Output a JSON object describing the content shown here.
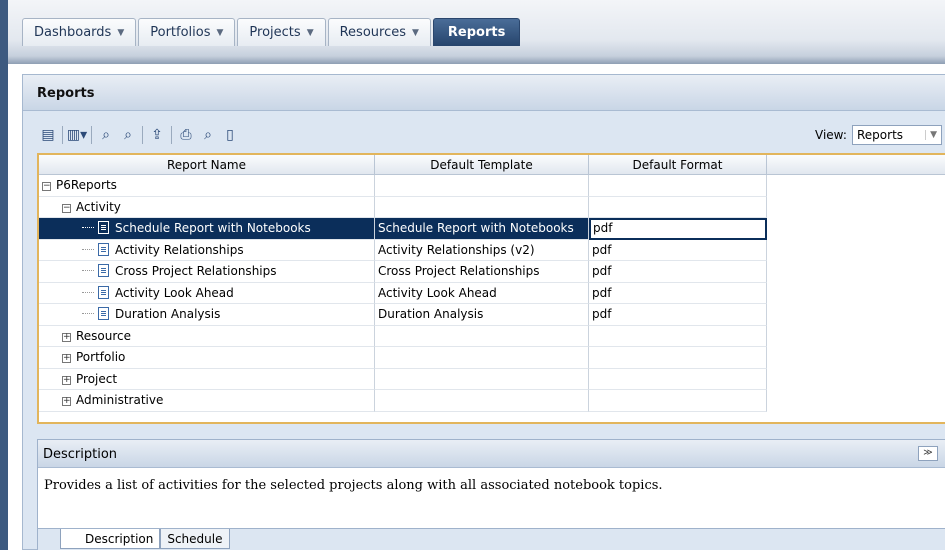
{
  "nav": {
    "tabs": [
      {
        "label": "Dashboards",
        "has_menu": true
      },
      {
        "label": "Portfolios",
        "has_menu": true
      },
      {
        "label": "Projects",
        "has_menu": true
      },
      {
        "label": "Resources",
        "has_menu": true
      },
      {
        "label": "Reports",
        "has_menu": false,
        "active": true
      }
    ]
  },
  "page": {
    "title": "Reports"
  },
  "toolbar": {
    "icons": [
      "open-report-icon",
      "columns-icon",
      "find-icon",
      "find-next-icon",
      "export-icon",
      "print-icon",
      "print-preview-icon",
      "page-setup-icon"
    ],
    "view_label": "View:",
    "view_value": "Reports"
  },
  "grid": {
    "columns": [
      "Report Name",
      "Default Template",
      "Default Format"
    ],
    "rows": [
      {
        "level": 0,
        "toggle": "−",
        "name": "P6Reports",
        "template": "",
        "format": ""
      },
      {
        "level": 1,
        "toggle": "−",
        "name": "Activity",
        "template": "",
        "format": ""
      },
      {
        "level": 2,
        "leaf": true,
        "name": "Schedule Report with Notebooks",
        "template": "Schedule Report with Notebooks",
        "format": "pdf",
        "selected": true
      },
      {
        "level": 2,
        "leaf": true,
        "name": "Activity Relationships",
        "template": "Activity Relationships (v2)",
        "format": "pdf"
      },
      {
        "level": 2,
        "leaf": true,
        "name": "Cross Project Relationships",
        "template": "Cross Project Relationships",
        "format": "pdf"
      },
      {
        "level": 2,
        "leaf": true,
        "name": "Activity Look Ahead",
        "template": "Activity Look Ahead",
        "format": "pdf"
      },
      {
        "level": 2,
        "leaf": true,
        "name": "Duration Analysis",
        "template": "Duration Analysis",
        "format": "pdf"
      },
      {
        "level": 1,
        "toggle": "+",
        "name": "Resource",
        "template": "",
        "format": ""
      },
      {
        "level": 1,
        "toggle": "+",
        "name": "Portfolio",
        "template": "",
        "format": ""
      },
      {
        "level": 1,
        "toggle": "+",
        "name": "Project",
        "template": "",
        "format": ""
      },
      {
        "level": 1,
        "toggle": "+",
        "name": "Administrative",
        "template": "",
        "format": ""
      }
    ]
  },
  "description": {
    "title": "Description",
    "text": "Provides a list of activities for the selected projects along with all associated notebook topics.",
    "tabs": [
      "Description",
      "Schedule"
    ]
  }
}
